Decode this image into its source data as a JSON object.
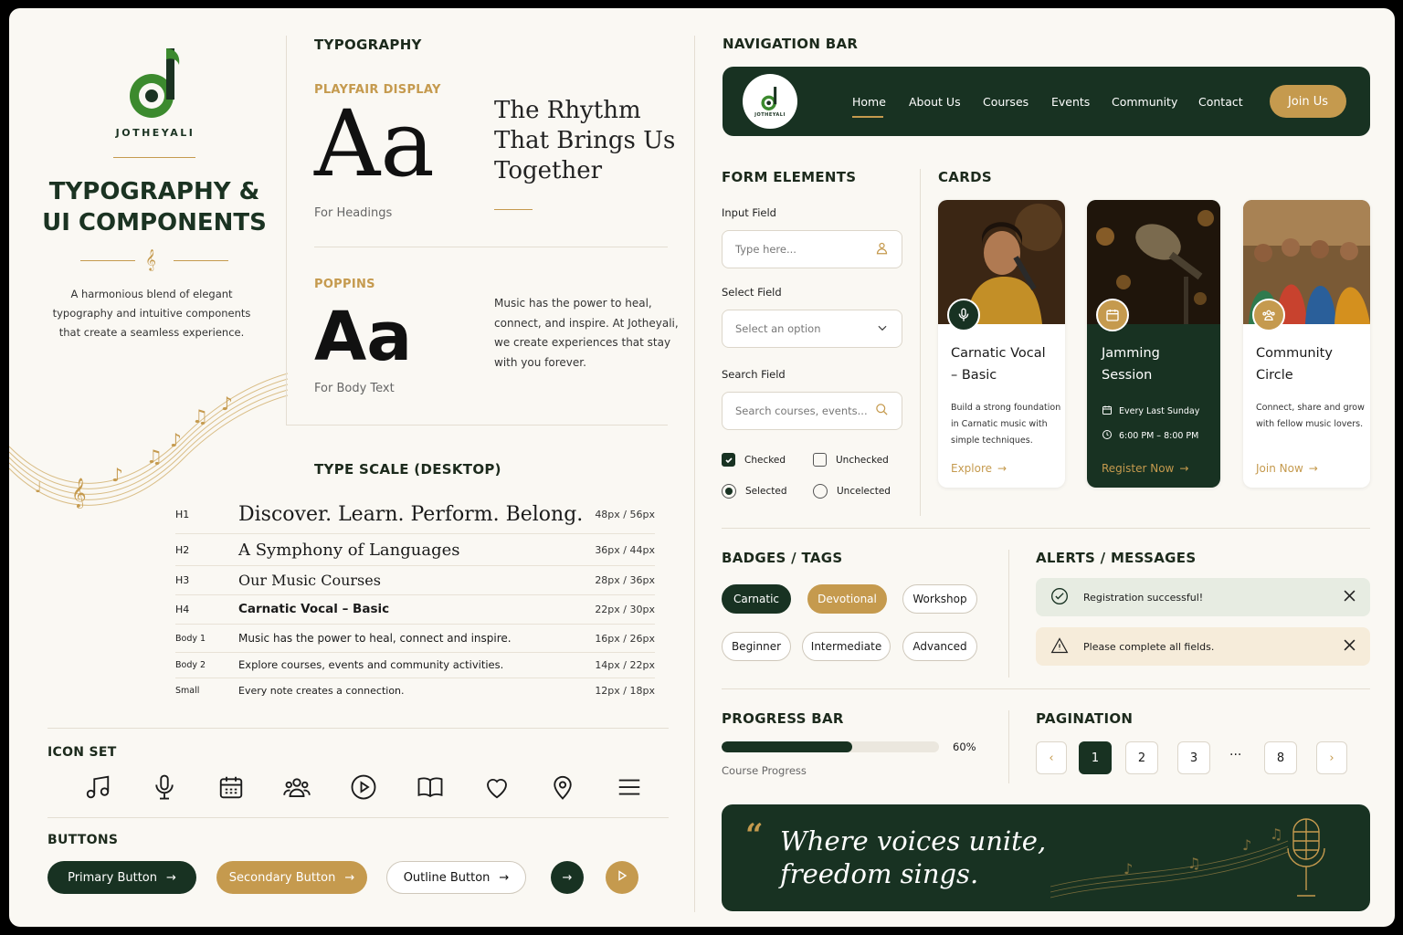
{
  "brand": {
    "name": "JOTHEYALI"
  },
  "hero": {
    "title_line1": "TYPOGRAPHY &",
    "title_line2": "UI COMPONENTS",
    "desc_line1": "A harmonious blend of elegant",
    "desc_line2": "typography and intuitive components",
    "desc_line3": "that create a seamless experience."
  },
  "typography": {
    "heading": "TYPOGRAPHY",
    "display_font": "PLAYFAIR DISPLAY",
    "display_sample": "Aa",
    "display_use": "For Headings",
    "display_quote_line1": "The Rhythm",
    "display_quote_line2": "That Brings Us",
    "display_quote_line3": "Together",
    "body_font": "POPPINS",
    "body_sample": "Aa",
    "body_use": "For Body Text",
    "body_para_line1": "Music has the power to heal,",
    "body_para_line2": "connect, and inspire. At Jotheyali,",
    "body_para_line3": "we create experiences that stay",
    "body_para_line4": "with you forever."
  },
  "type_scale": {
    "heading": "TYPE SCALE (DESKTOP)",
    "rows": [
      {
        "tag": "H1",
        "sample": "Discover. Learn. Perform. Belong.",
        "size": "48px / 56px"
      },
      {
        "tag": "H2",
        "sample": "A Symphony of Languages",
        "size": "36px / 44px"
      },
      {
        "tag": "H3",
        "sample": "Our Music Courses",
        "size": "28px / 36px"
      },
      {
        "tag": "H4",
        "sample": "Carnatic Vocal – Basic",
        "size": "22px / 30px"
      },
      {
        "tag": "Body 1",
        "sample": "Music has the power to heal, connect and inspire.",
        "size": "16px / 26px"
      },
      {
        "tag": "Body 2",
        "sample": "Explore courses, events and community activities.",
        "size": "14px / 22px"
      },
      {
        "tag": "Small",
        "sample": "Every note creates a connection.",
        "size": "12px / 18px"
      }
    ]
  },
  "icon_set": {
    "heading": "ICON SET",
    "icons": [
      "music-note-icon",
      "microphone-icon",
      "calendar-icon",
      "users-icon",
      "play-circle-icon",
      "book-icon",
      "heart-icon",
      "map-pin-icon",
      "menu-icon"
    ]
  },
  "buttons": {
    "heading": "BUTTONS",
    "primary": "Primary Button",
    "secondary": "Secondary Button",
    "outline": "Outline Button"
  },
  "navbar": {
    "heading": "NAVIGATION BAR",
    "links": [
      "Home",
      "About Us",
      "Courses",
      "Events",
      "Community",
      "Contact"
    ],
    "active": "Home",
    "cta": "Join Us"
  },
  "form": {
    "heading": "FORM ELEMENTS",
    "input_label": "Input Field",
    "input_placeholder": "Type here...",
    "select_label": "Select Field",
    "select_value": "Select an option",
    "search_label": "Search Field",
    "search_placeholder": "Search courses, events...",
    "checked": "Checked",
    "unchecked": "Unchecked",
    "selected": "Selected",
    "unselected": "Uncelected"
  },
  "cards": {
    "heading": "CARDS",
    "items": [
      {
        "title_line1": "Carnatic Vocal",
        "title_line2": "– Basic",
        "desc_line1": "Build a strong foundation",
        "desc_line2": "in Carnatic music with",
        "desc_line3": "simple techniques.",
        "link": "Explore"
      },
      {
        "title_line1": "Jamming",
        "title_line2": "Session",
        "when": "Every Last Sunday",
        "time": "6:00 PM – 8:00 PM",
        "link": "Register Now"
      },
      {
        "title_line1": "Community",
        "title_line2": "Circle",
        "desc_line1": "Connect, share and grow",
        "desc_line2": "with fellow music lovers.",
        "link": "Join Now"
      }
    ]
  },
  "badges": {
    "heading": "BADGES / TAGS",
    "items": [
      "Carnatic",
      "Devotional",
      "Workshop",
      "Beginner",
      "Intermediate",
      "Advanced"
    ]
  },
  "alerts": {
    "heading": "ALERTS / MESSAGES",
    "success": "Registration successful!",
    "warning": "Please complete all fields."
  },
  "progress": {
    "heading": "PROGRESS BAR",
    "value": 0.6,
    "value_label": "60%",
    "label": "Course Progress"
  },
  "pagination": {
    "heading": "PAGINATION",
    "pages": [
      "1",
      "2",
      "3",
      "8"
    ],
    "ellipsis": "···",
    "current": "1"
  },
  "quote": {
    "mark": "“",
    "line1": "Where voices unite,",
    "line2": "freedom sings."
  },
  "colors": {
    "dark_green": "#183222",
    "gold": "#c59a4e",
    "cream": "#faf8f3",
    "logo_green": "#3c8a2e"
  }
}
